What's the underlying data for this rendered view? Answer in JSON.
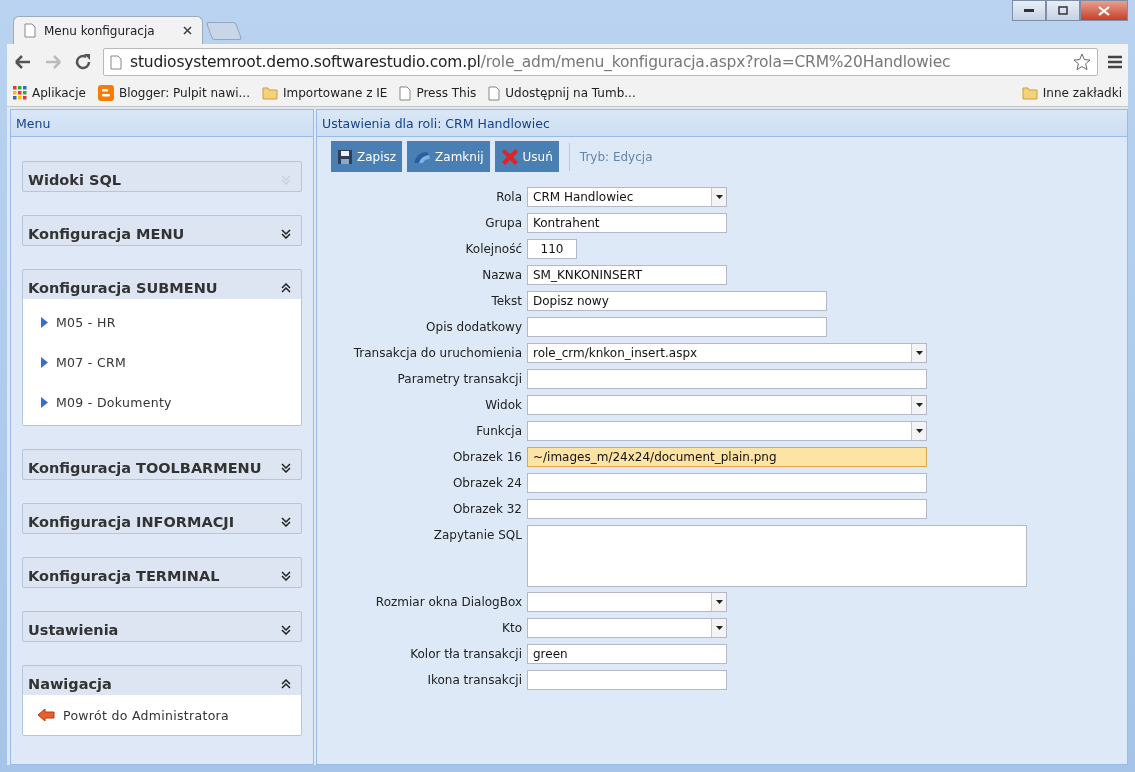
{
  "browser": {
    "tabs": [
      {
        "title": "Menu konfiguracja",
        "selected": true
      }
    ],
    "address": {
      "host": "studiosystemroot.demo.softwarestudio.com.pl",
      "path": "/role_adm/menu_konfiguracja.aspx?rola=CRM%20Handlowiec"
    },
    "bookmarks": [
      {
        "kind": "apps",
        "label": "Aplikacje"
      },
      {
        "kind": "blogger",
        "label": "Blogger: Pulpit nawi..."
      },
      {
        "kind": "folder",
        "label": "Importowane z IE"
      },
      {
        "kind": "page",
        "label": "Press This"
      },
      {
        "kind": "page",
        "label": "Udostępnij na Tumb..."
      }
    ],
    "other_bookmarks": "Inne zakładki"
  },
  "sidebar": {
    "title": "Menu",
    "sections": [
      {
        "title": "Widoki SQL",
        "expanded": false,
        "disabled": true
      },
      {
        "title": "Konfiguracja MENU",
        "expanded": false,
        "disabled": false
      },
      {
        "title": "Konfiguracja SUBMENU",
        "expanded": true,
        "disabled": false,
        "items": [
          {
            "kind": "node",
            "label": "M05 - HR"
          },
          {
            "kind": "node",
            "label": "M07 - CRM"
          },
          {
            "kind": "node",
            "label": "M09 - Dokumenty"
          }
        ]
      },
      {
        "title": "Konfiguracja TOOLBARMENU",
        "expanded": false,
        "disabled": false
      },
      {
        "title": "Konfiguracja INFORMACJI",
        "expanded": false,
        "disabled": false
      },
      {
        "title": "Konfiguracja TERMINAL",
        "expanded": false,
        "disabled": false
      },
      {
        "title": "Ustawienia",
        "expanded": false,
        "disabled": false
      },
      {
        "title": "Nawigacja",
        "expanded": true,
        "disabled": false,
        "items": [
          {
            "kind": "back",
            "label": "Powrót do Administratora"
          }
        ]
      }
    ]
  },
  "main": {
    "title": "Ustawienia dla roli: CRM Handlowiec",
    "toolbar": [
      {
        "kind": "save",
        "label": "Zapisz"
      },
      {
        "kind": "close",
        "label": "Zamknij"
      },
      {
        "kind": "delete",
        "label": "Usuń"
      }
    ],
    "mode": "Tryb: Edycja",
    "fields": [
      {
        "label": "Rola",
        "kind": "select",
        "value": "CRM Handlowiec",
        "focused": false
      },
      {
        "label": "Grupa",
        "kind": "text",
        "value": "Kontrahent",
        "focused": false
      },
      {
        "label": "Kolejność",
        "kind": "number",
        "value": "110",
        "focused": false
      },
      {
        "label": "Nazwa",
        "kind": "text",
        "value": "SM_KNKONINSERT",
        "focused": false
      },
      {
        "label": "Tekst",
        "kind": "text",
        "value": "Dopisz nowy",
        "focused": false
      },
      {
        "label": "Opis dodatkowy",
        "kind": "text",
        "focused": false
      },
      {
        "label": "Transakcja do uruchomienia",
        "kind": "select",
        "value": "role_crm/knkon_insert.aspx",
        "focused": false
      },
      {
        "label": "Parametry transakcji",
        "kind": "text",
        "focused": false
      },
      {
        "label": "Widok",
        "kind": "select",
        "focused": false
      },
      {
        "label": "Funkcja",
        "kind": "select",
        "focused": false
      },
      {
        "label": "Obrazek 16",
        "kind": "text",
        "value": "~/images_m/24x24/document_plain.png",
        "focused": true
      },
      {
        "label": "Obrazek 24",
        "kind": "text",
        "focused": false
      },
      {
        "label": "Obrazek 32",
        "kind": "text",
        "focused": false
      },
      {
        "label": "Zapytanie SQL",
        "kind": "textarea",
        "focused": false
      },
      {
        "label": "Rozmiar okna DialogBox",
        "kind": "select",
        "focused": false
      },
      {
        "label": "Kto",
        "kind": "select",
        "focused": false
      },
      {
        "label": "Kolor tła transakcji",
        "kind": "text",
        "value": "green",
        "focused": false
      },
      {
        "label": "Ikona transakcji",
        "kind": "text",
        "focused": false
      }
    ]
  }
}
